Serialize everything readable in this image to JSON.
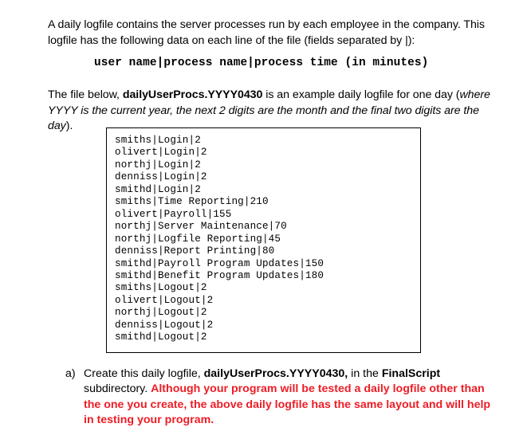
{
  "document": {
    "intro": {
      "line_text": "A daily logfile contains the server processes run by each employee in the company.  This logfile has the following data on each line of the file (fields separated by |):"
    },
    "format_spec": "user name|process name|process time (in minutes)",
    "example_intro": {
      "prefix": "The file below, ",
      "filename": "dailyUserProcs.YYYY0430",
      "middle": " is an example daily logfile for one day (",
      "italic_note": "where YYYY is the current year, the next 2 digits are the month and the final two digits are the day",
      "suffix": ")."
    },
    "logfile": {
      "lines": [
        "smiths|Login|2",
        "olivert|Login|2",
        "northj|Login|2",
        "denniss|Login|2",
        "smithd|Login|2",
        "smiths|Time Reporting|210",
        "olivert|Payroll|155",
        "northj|Server Maintenance|70",
        "northj|Logfile Reporting|45",
        "denniss|Report Printing|80",
        "smithd|Payroll Program Updates|150",
        "smithd|Benefit Program Updates|180",
        "smiths|Logout|2",
        "olivert|Logout|2",
        "northj|Logout|2",
        "denniss|Logout|2",
        "smithd|Logout|2"
      ]
    },
    "task_a": {
      "marker": "a)",
      "part1": "Create this daily logfile, ",
      "filename": "dailyUserProcs.YYYY0430,",
      "part2": " in the ",
      "directory": "FinalScript",
      "part3": " subdirectory.  ",
      "red_warning": "Although your program will be tested a daily logfile other than the one you create, the above daily logfile has the same layout and will help in testing your program."
    },
    "colors": {
      "text": "#000000",
      "warning_red": "#EE1C25",
      "background": "#FFFFFF",
      "box_border": "#000000"
    }
  }
}
